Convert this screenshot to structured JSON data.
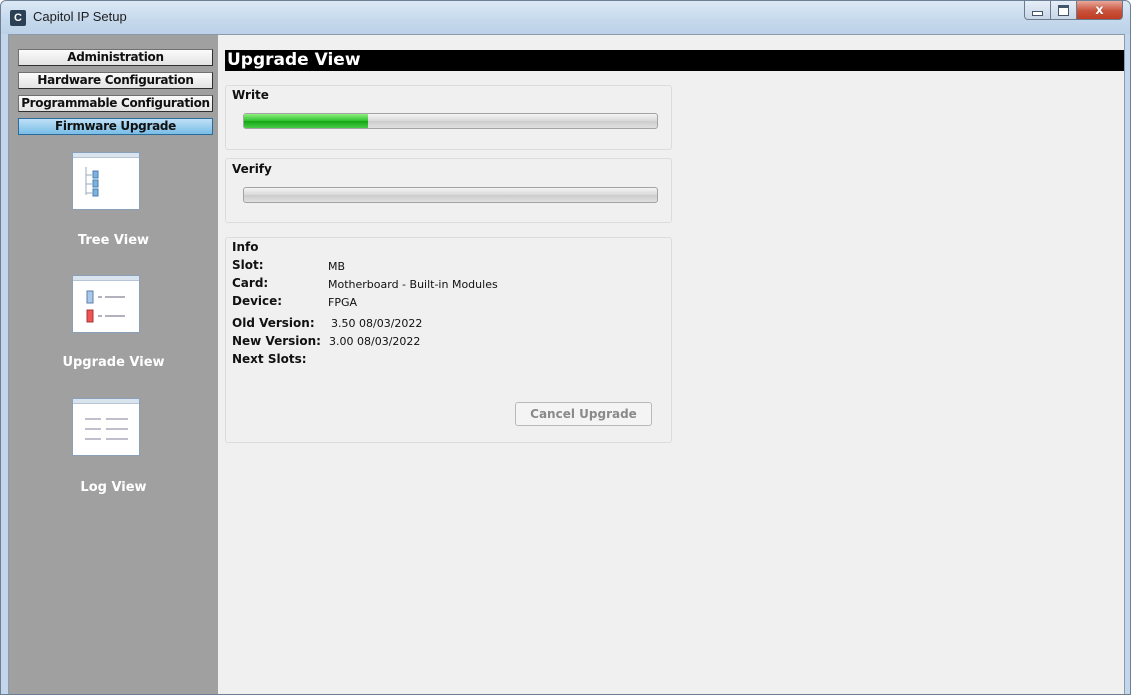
{
  "window": {
    "title": "Capitol IP Setup",
    "app_icon_letter": "C",
    "icons": {
      "minimize": "minimize-icon",
      "maximize": "maximize-icon",
      "close": "close-icon",
      "close_glyph": "x"
    }
  },
  "sidebar": {
    "buttons": [
      "Administration",
      "Hardware Configuration",
      "Programmable Configuration",
      "Firmware Upgrade"
    ],
    "active_button": "Firmware Upgrade",
    "views": [
      {
        "label": "Tree View",
        "icon": "tree-view-icon"
      },
      {
        "label": "Upgrade View",
        "icon": "upgrade-view-icon"
      },
      {
        "label": "Log View",
        "icon": "log-view-icon"
      }
    ]
  },
  "main": {
    "header": "Upgrade View",
    "write": {
      "label": "Write",
      "progress_percent": 30
    },
    "verify": {
      "label": "Verify",
      "progress_percent": 0
    },
    "info": {
      "label": "Info",
      "rows": [
        {
          "key": "Slot:",
          "value": "MB"
        },
        {
          "key": "Card:",
          "value": "Motherboard - Built-in Modules"
        },
        {
          "key": "Device:",
          "value": "FPGA"
        },
        {
          "key": "Old Version:",
          "value": "3.50 08/03/2022"
        },
        {
          "key": "New Version:",
          "value": "3.00 08/03/2022"
        },
        {
          "key": "Next Slots:",
          "value": ""
        }
      ],
      "cancel_label": "Cancel Upgrade"
    }
  },
  "colors": {
    "progress_green": "#2ec02e",
    "sidebar_bg": "#a0a0a0",
    "header_bg": "#000000",
    "active_button": "#79bde6"
  }
}
